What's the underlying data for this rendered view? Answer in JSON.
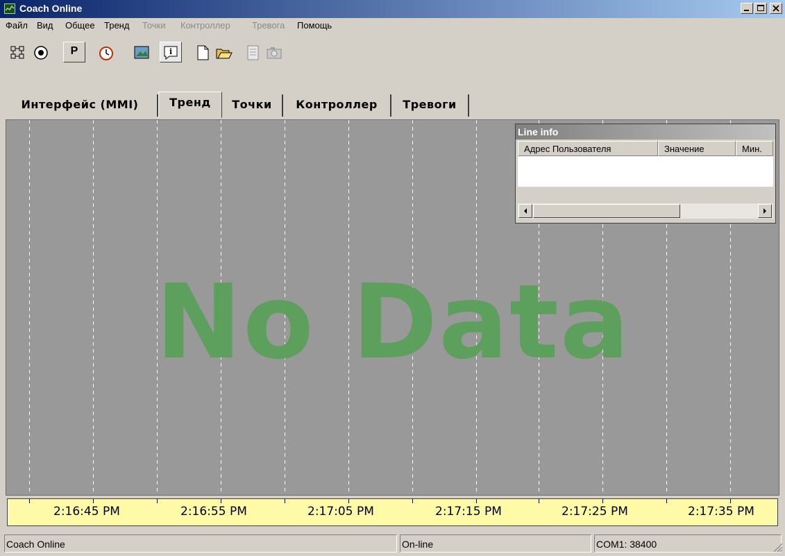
{
  "window": {
    "title": "Coach Online"
  },
  "menu": [
    {
      "label": "Файл",
      "disabled": false
    },
    {
      "label": "Вид",
      "disabled": false
    },
    {
      "label": "Общее",
      "disabled": false
    },
    {
      "label": "Тренд",
      "disabled": false
    },
    {
      "label": "Точки",
      "disabled": true
    },
    {
      "label": "Контроллер",
      "disabled": true
    },
    {
      "label": "Тревога",
      "disabled": true
    },
    {
      "label": "Помощь",
      "disabled": false
    }
  ],
  "toolbar": {
    "p_label": "P",
    "icons": [
      "network-icon",
      "eye-icon",
      "p-icon",
      "clock-icon",
      "image-icon",
      "info-icon",
      "new-file-icon",
      "open-folder-icon",
      "notepad-icon",
      "camera-icon"
    ]
  },
  "tabs": [
    {
      "label": "Интерфейс (MMI)",
      "active": false
    },
    {
      "label": "Тренд",
      "active": true
    },
    {
      "label": "Точки",
      "active": false
    },
    {
      "label": "Контроллер",
      "active": false
    },
    {
      "label": "Тревоги",
      "active": false
    }
  ],
  "chart": {
    "nodata_text": "No Data",
    "background_color": "#999999",
    "nodata_color": "#5aa05a"
  },
  "line_info": {
    "title": "Line info",
    "columns": [
      "Адрес Пользователя",
      "Значение",
      "Мин."
    ]
  },
  "time_axis": {
    "labels": [
      "2:16:45 PM",
      "2:16:55 PM",
      "2:17:05 PM",
      "2:17:15 PM",
      "2:17:25 PM",
      "2:17:35 PM"
    ]
  },
  "status": {
    "app": "Coach Online",
    "connection": "On-line",
    "port": "COM1: 38400"
  }
}
